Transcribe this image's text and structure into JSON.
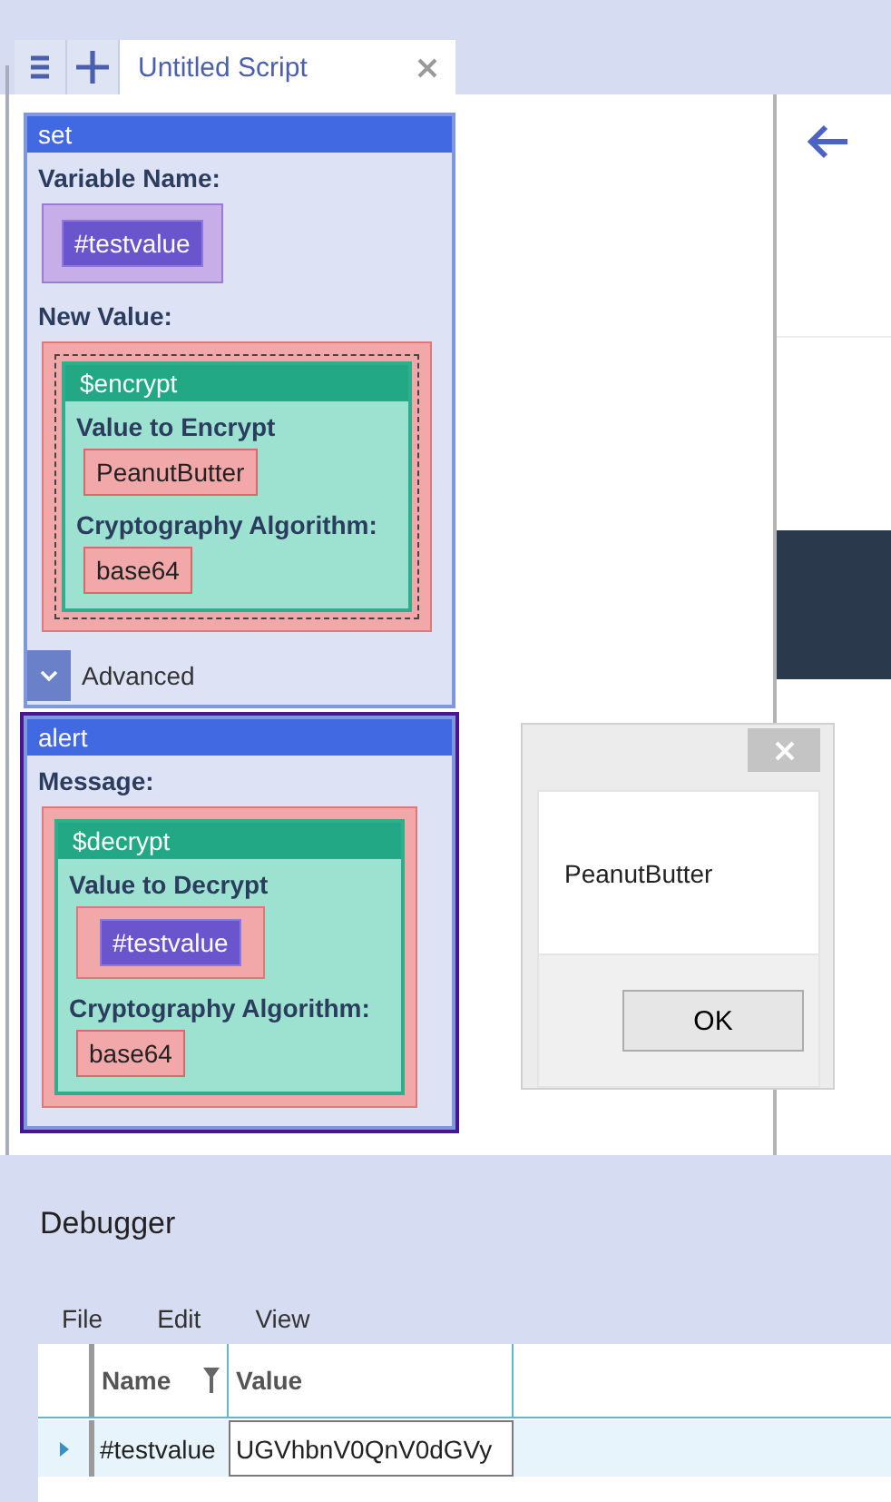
{
  "tabs": [
    {
      "label": "Untitled Script",
      "selected": true
    }
  ],
  "blocks": [
    {
      "title": "set",
      "selected": false,
      "params": [
        {
          "label": "Variable Name:",
          "kind": "variable",
          "highlighted": false,
          "value": {
            "kind": "variable",
            "text": "#testvalue"
          }
        },
        {
          "label": "New Value:",
          "kind": "value",
          "highlighted": true,
          "value": {
            "kind": "function",
            "title": "$encrypt",
            "params": [
              {
                "label": "Value to Encrypt",
                "kind": "value",
                "highlighted": false,
                "value": {
                  "kind": "text",
                  "text": "PeanutButter"
                }
              },
              {
                "label": "Cryptography Algorithm:",
                "kind": "value",
                "highlighted": false,
                "value": {
                  "kind": "text",
                  "text": "base64"
                }
              }
            ]
          }
        }
      ],
      "advanced": {
        "label": "Advanced",
        "expanded": false
      }
    },
    {
      "title": "alert",
      "selected": true,
      "params": [
        {
          "label": "Message:",
          "kind": "value",
          "highlighted": false,
          "value": {
            "kind": "function",
            "title": "$decrypt",
            "params": [
              {
                "label": "Value to Decrypt",
                "kind": "value",
                "highlighted": false,
                "value": {
                  "kind": "variable",
                  "text": "#testvalue"
                }
              },
              {
                "label": "Cryptography Algorithm:",
                "kind": "value",
                "highlighted": false,
                "value": {
                  "kind": "text",
                  "text": "base64"
                }
              }
            ]
          }
        }
      ]
    }
  ],
  "dialog": {
    "message": "PeanutButter",
    "button": "OK"
  },
  "debugger": {
    "title": "Debugger",
    "menu": [
      "File",
      "Edit",
      "View"
    ],
    "table": {
      "columns": [
        {
          "label": "Name",
          "filter": true
        },
        {
          "label": "Value",
          "filter": false
        }
      ],
      "rows": [
        {
          "selected": true,
          "editing_value": true,
          "cells": [
            "#testvalue",
            "UGVhbnV0QnV0dGVy"
          ]
        }
      ]
    }
  }
}
